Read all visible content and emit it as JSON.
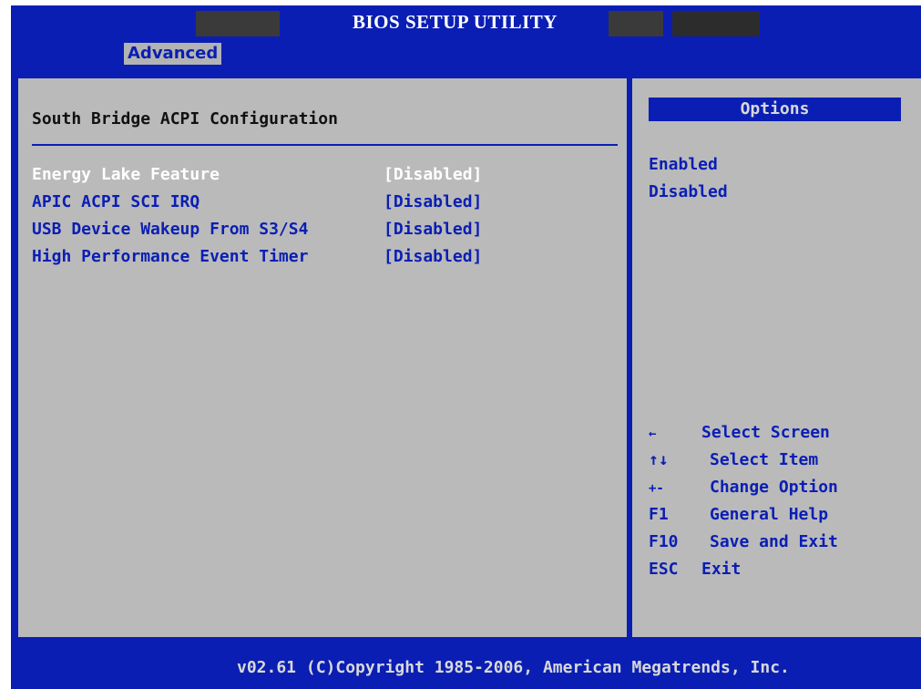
{
  "window": {
    "title": "BIOS SETUP UTILITY"
  },
  "menu": {
    "active_tab": "Advanced"
  },
  "section": {
    "title": "South Bridge ACPI Configuration",
    "settings": [
      {
        "label": "Energy Lake Feature",
        "value": "[Disabled]",
        "selected": true
      },
      {
        "label": "APIC ACPI SCI IRQ",
        "value": "[Disabled]",
        "selected": false
      },
      {
        "label": "USB Device Wakeup From S3/S4",
        "value": "[Disabled]",
        "selected": false
      },
      {
        "label": "High Performance Event Timer",
        "value": "[Disabled]",
        "selected": false
      }
    ]
  },
  "options": {
    "header": "Options",
    "items": [
      "Enabled",
      "Disabled"
    ]
  },
  "help": {
    "keys": [
      {
        "key": "←",
        "action": "Select Screen",
        "icon": "left-arrow-icon"
      },
      {
        "key": "↑↓",
        "action": "Select Item",
        "icon": "up-down-arrows-icon"
      },
      {
        "key": "+-",
        "action": "Change Option",
        "icon": "plus-minus-icon"
      },
      {
        "key": "F1",
        "action": "General Help"
      },
      {
        "key": "F10",
        "action": "Save and Exit"
      },
      {
        "key": "ESC",
        "action": "Exit"
      }
    ]
  },
  "footer": {
    "text": "v02.61 (C)Copyright 1985-2006, American Megatrends, Inc."
  },
  "colors": {
    "bios_blue": "#0a1eb4",
    "panel_gray": "#bababa",
    "selected_text": "#ffffff"
  }
}
